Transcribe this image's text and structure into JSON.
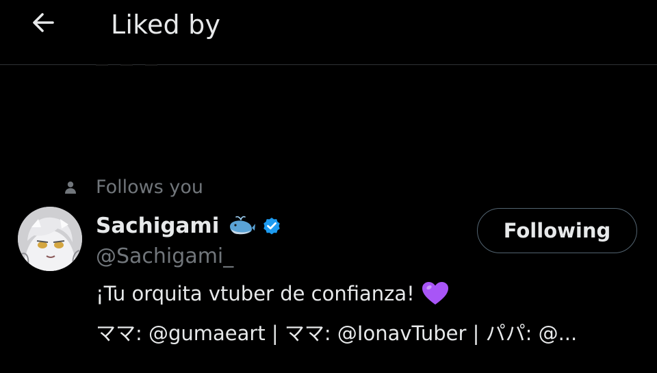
{
  "header": {
    "title": "Liked by",
    "back_icon": "arrow-left-icon"
  },
  "user": {
    "social_context": "Follows you",
    "social_context_icon": "person-icon",
    "display_name": "Sachigami",
    "name_emoji": "whale-emoji",
    "verified_icon": "verified-badge-icon",
    "verified_color": "#1d9bf0",
    "handle": "@Sachigami_",
    "follow_button_label": "Following",
    "bio_line_1": "¡Tu orquita vtuber de confianza!",
    "bio_line_1_emoji": "purple-heart-emoji",
    "bio_line_2": "ママ: @gumaeart | ママ: @IonavTuber | パパ: @..."
  },
  "colors": {
    "background": "#000000",
    "primary_text": "#e7e9ea",
    "secondary_text": "#71767b",
    "divider": "#2f3336",
    "heart": "#a855f7"
  }
}
